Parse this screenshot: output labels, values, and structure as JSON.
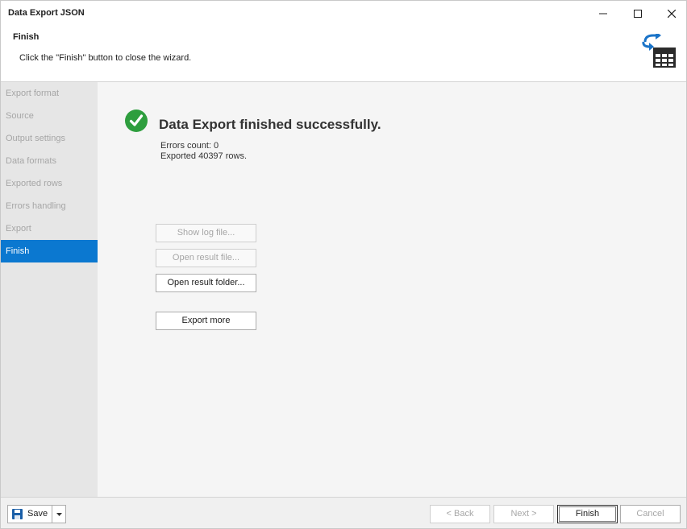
{
  "window": {
    "title": "Data Export JSON",
    "controls": {
      "minimize": "–",
      "maximize": "☐",
      "close": "✕"
    }
  },
  "header": {
    "title": "Finish",
    "subtitle": "Click the \"Finish\" button to close the wizard.",
    "icon": "export-table-icon"
  },
  "sidebar": {
    "items": [
      {
        "label": "Export format",
        "active": false
      },
      {
        "label": "Source",
        "active": false
      },
      {
        "label": "Output settings",
        "active": false
      },
      {
        "label": "Data formats",
        "active": false
      },
      {
        "label": "Exported rows",
        "active": false
      },
      {
        "label": "Errors handling",
        "active": false
      },
      {
        "label": "Export",
        "active": false
      },
      {
        "label": "Finish",
        "active": true
      }
    ]
  },
  "result": {
    "icon": "success-check-icon",
    "title": "Data Export finished successfully.",
    "errors_count": "Errors count: 0",
    "exported_rows": "Exported 40397 rows."
  },
  "actions": {
    "show_log": {
      "label": "Show log file...",
      "enabled": false
    },
    "open_result_file": {
      "label": "Open result file...",
      "enabled": false
    },
    "open_result_folder": {
      "label": "Open result folder...",
      "enabled": true
    },
    "export_more": {
      "label": "Export more",
      "enabled": true
    }
  },
  "footer": {
    "save_label": "Save",
    "back_label": "< Back",
    "next_label": "Next >",
    "finish_label": "Finish",
    "cancel_label": "Cancel"
  },
  "colors": {
    "accent": "#0b78d0",
    "success": "#2e9e3e",
    "disabled_text": "#a6a6a6"
  }
}
